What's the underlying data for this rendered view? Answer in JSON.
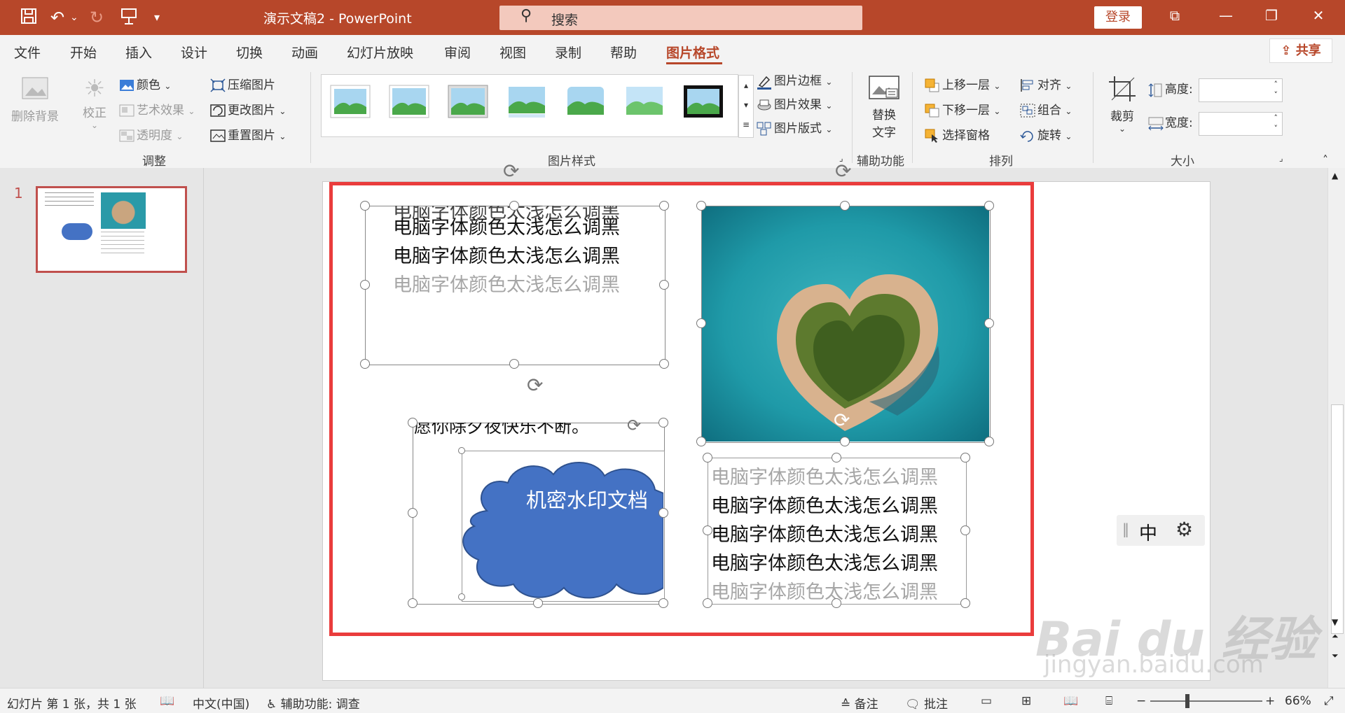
{
  "titlebar": {
    "doc_title": "演示文稿2 - PowerPoint",
    "search_placeholder": "搜索",
    "login_label": "登录",
    "icons": [
      "save-icon",
      "undo-icon",
      "redo-icon",
      "present-icon",
      "customize-icon",
      "ribbon-display-icon",
      "minimize-icon",
      "restore-icon",
      "close-icon"
    ]
  },
  "menu": {
    "tabs": [
      "文件",
      "开始",
      "插入",
      "设计",
      "切换",
      "动画",
      "幻灯片放映",
      "审阅",
      "视图",
      "录制",
      "帮助",
      "图片格式"
    ],
    "active_tab": "图片格式",
    "share_label": "共享"
  },
  "ribbon": {
    "adjust": {
      "remove_bg": "删除背景",
      "corrections": "校正",
      "color": "颜色",
      "artistic": "艺术效果",
      "transparency": "透明度",
      "compress": "压缩图片",
      "change": "更改图片",
      "reset": "重置图片",
      "group_label": "调整"
    },
    "styles": {
      "border": "图片边框",
      "effects": "图片效果",
      "layout": "图片版式",
      "group_label": "图片样式"
    },
    "accessibility": {
      "alt_text_1": "替换",
      "alt_text_2": "文字",
      "group_label": "辅助功能"
    },
    "arrange": {
      "forward": "上移一层",
      "backward": "下移一层",
      "selection_pane": "选择窗格",
      "align": "对齐",
      "group": "组合",
      "rotate": "旋转",
      "group_label": "排列"
    },
    "size": {
      "crop": "裁剪",
      "height": "高度:",
      "width": "宽度:",
      "group_label": "大小"
    }
  },
  "slides_panel": {
    "slide_number": "1"
  },
  "slide": {
    "top_left_lines": [
      "电脑字体颜色太浅怎么调黑",
      "电脑字体颜色太浅怎么调黑",
      "电脑字体颜色太浅怎么调黑",
      "电脑字体颜色太浅怎么调黑"
    ],
    "partial_text": "愿你除夕夜快乐不断。",
    "cloud_text": "机密水印文档",
    "bottom_right_lines": [
      "电脑字体颜色太浅怎么调黑",
      "电脑字体颜色太浅怎么调黑",
      "电脑字体颜色太浅怎么调黑",
      "电脑字体颜色太浅怎么调黑",
      "电脑字体颜色太浅怎么调黑"
    ]
  },
  "ime": {
    "mode": "中"
  },
  "statusbar": {
    "slide_info": "幻灯片 第 1 张，共 1 张",
    "language": "中文(中国)",
    "accessibility": "辅助功能: 调查",
    "notes": "备注",
    "comments": "批注",
    "zoom": "66%"
  },
  "watermark": {
    "brand": "Bai du 经验",
    "url": "jingyan.baidu.com"
  },
  "colors": {
    "accent": "#b7472a",
    "frame": "#ea3c3c",
    "cloud": "#4472c4",
    "light_text": "#a6a6a6"
  }
}
